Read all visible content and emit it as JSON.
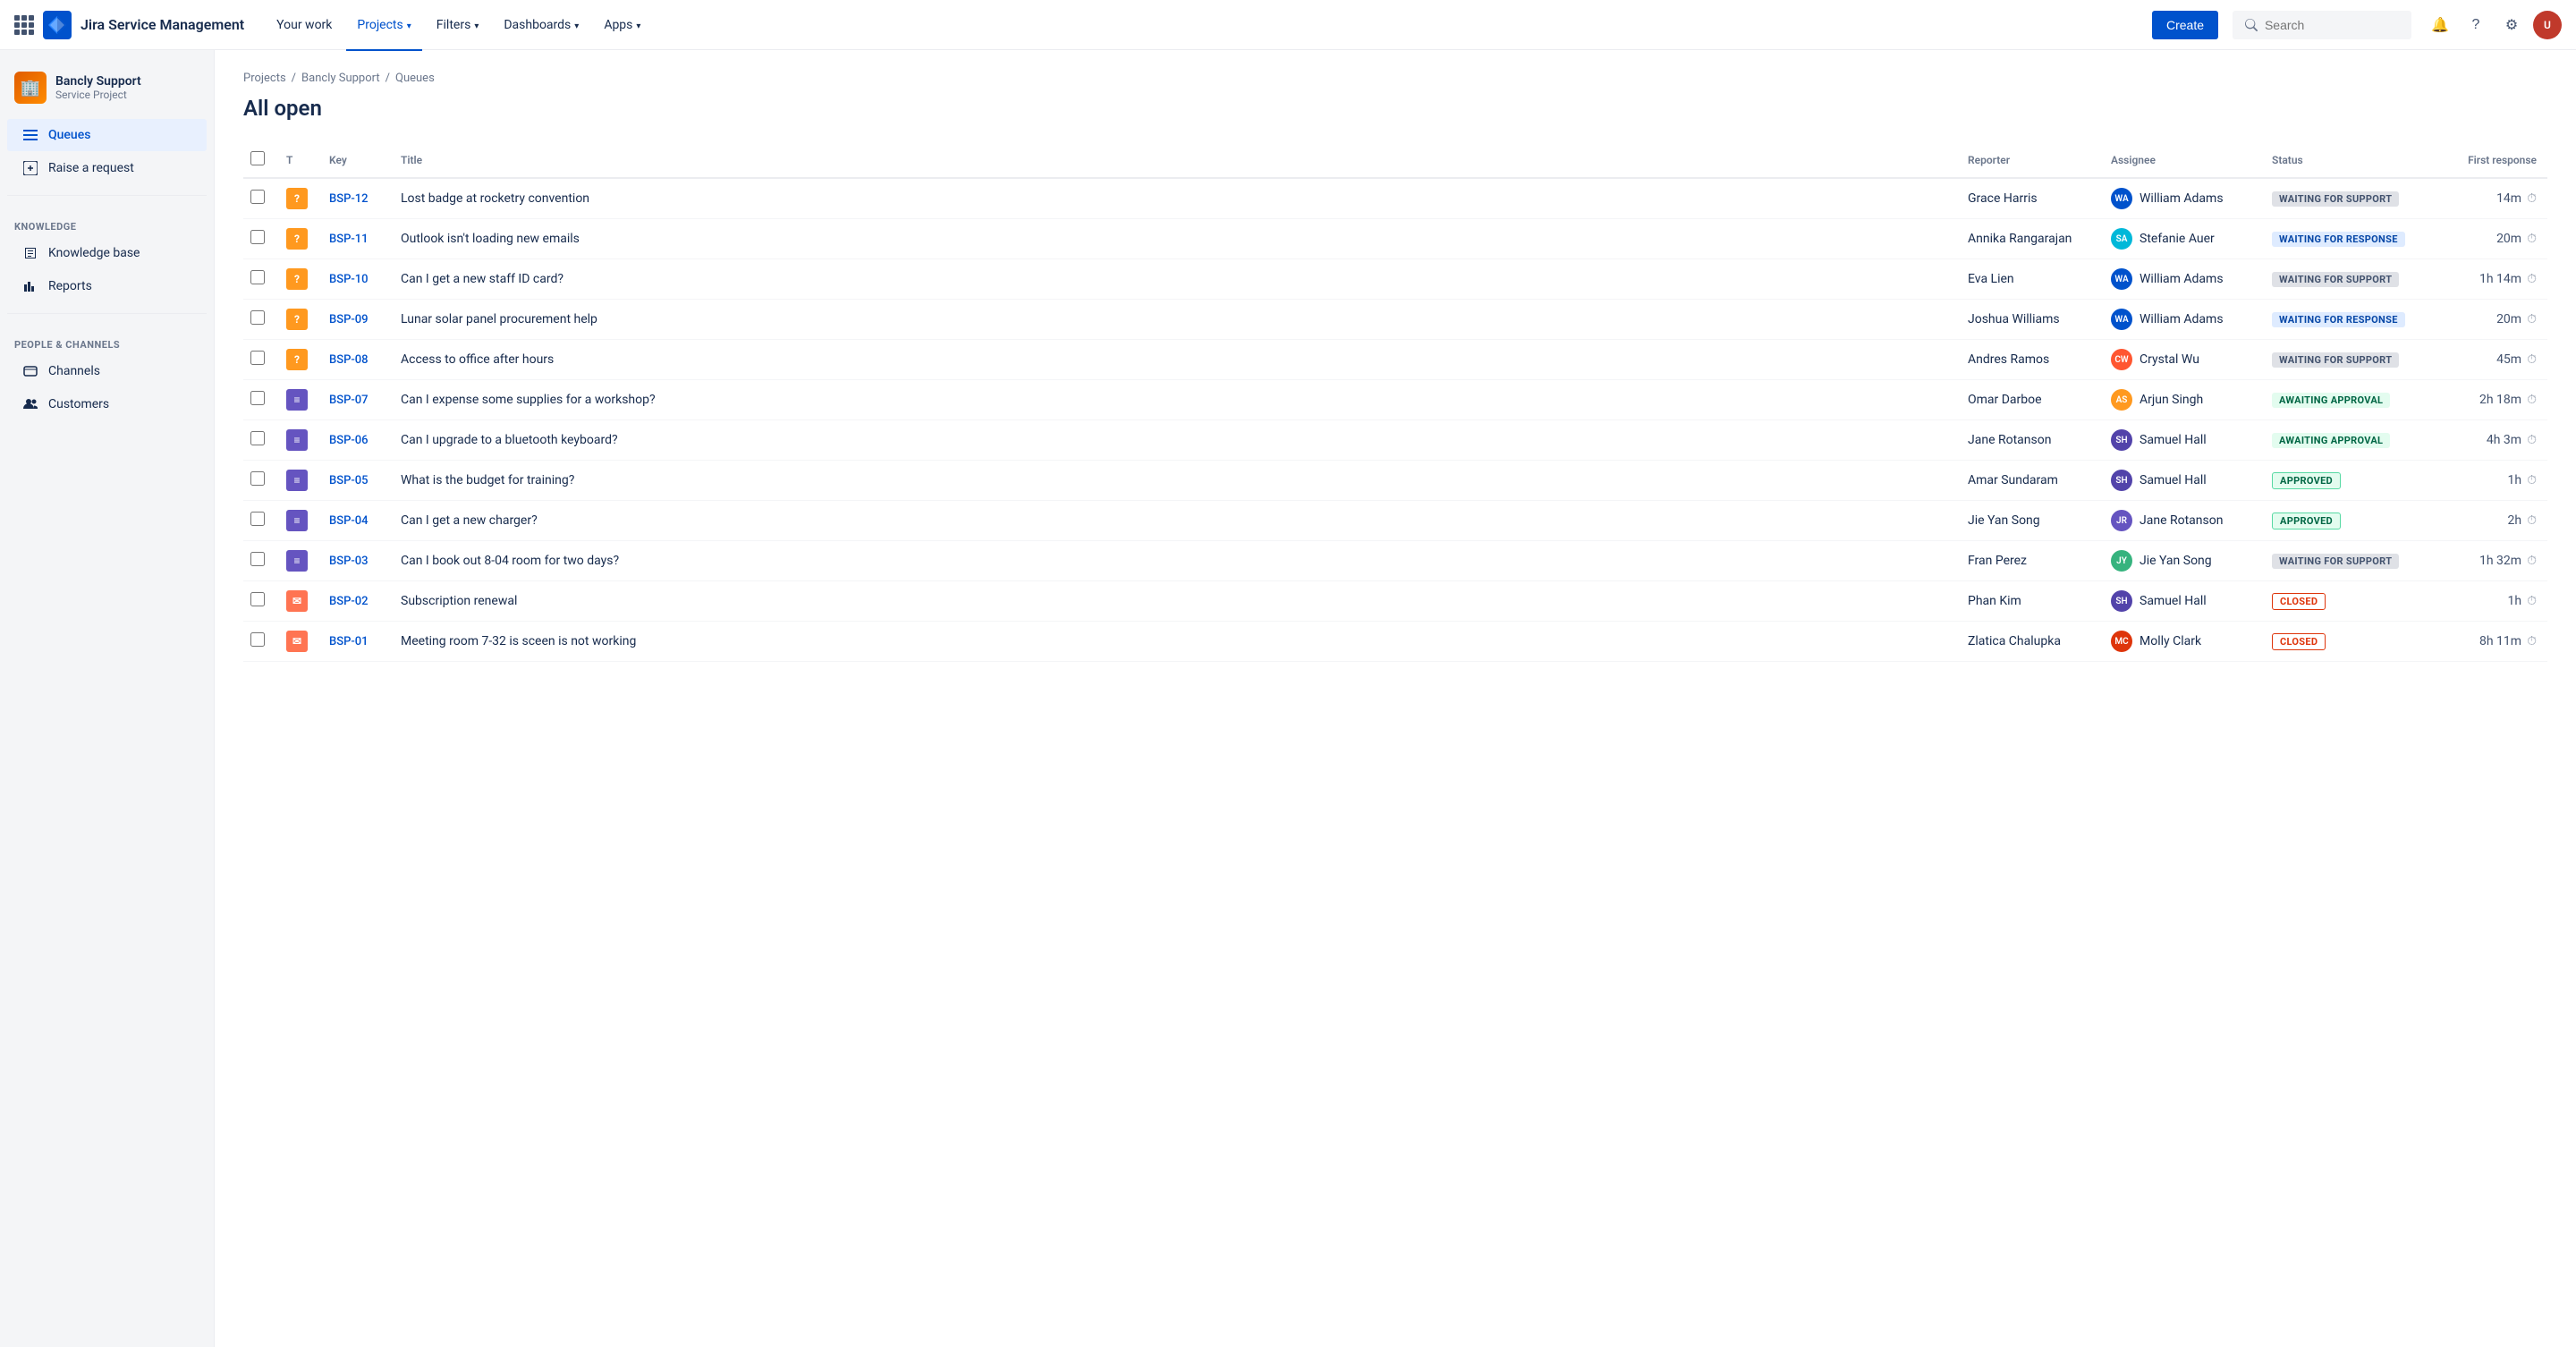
{
  "app": {
    "brand": "Jira Service Management",
    "logo_text": "⚡"
  },
  "topnav": {
    "your_work": "Your work",
    "projects": "Projects",
    "filters": "Filters",
    "dashboards": "Dashboards",
    "apps": "Apps",
    "create": "Create",
    "search_placeholder": "Search"
  },
  "sidebar": {
    "project_name": "Bancly Support",
    "project_type": "Service Project",
    "queues_label": "Queues",
    "raise_request_label": "Raise a request",
    "knowledge_section": "Knowledge",
    "knowledge_base_label": "Knowledge base",
    "reports_label": "Reports",
    "people_channels_section": "People & Channels",
    "channels_label": "Channels",
    "customers_label": "Customers"
  },
  "breadcrumb": {
    "projects": "Projects",
    "bancly_support": "Bancly Support",
    "queues": "Queues"
  },
  "page_title": "All open",
  "table": {
    "columns": {
      "type": "T",
      "key": "Key",
      "title": "Title",
      "reporter": "Reporter",
      "assignee": "Assignee",
      "status": "Status",
      "first_response": "First response"
    },
    "rows": [
      {
        "key": "BSP-12",
        "type": "question",
        "type_label": "?",
        "title": "Lost badge at rocketry convention",
        "reporter": "Grace Harris",
        "assignee": "William Adams",
        "assignee_initials": "WA",
        "assignee_color": "av-blue",
        "status": "WAITING FOR SUPPORT",
        "status_class": "status-waiting-support",
        "response": "14m"
      },
      {
        "key": "BSP-11",
        "type": "question",
        "type_label": "?",
        "title": "Outlook isn't loading new emails",
        "reporter": "Annika Rangarajan",
        "assignee": "Stefanie Auer",
        "assignee_initials": "SA",
        "assignee_color": "av-teal",
        "status": "WAITING FOR RESPONSE",
        "status_class": "status-waiting-response",
        "response": "20m"
      },
      {
        "key": "BSP-10",
        "type": "question",
        "type_label": "?",
        "title": "Can I get a new staff ID card?",
        "reporter": "Eva Lien",
        "assignee": "William Adams",
        "assignee_initials": "WA",
        "assignee_color": "av-blue",
        "status": "WAITING FOR SUPPORT",
        "status_class": "status-waiting-support",
        "response": "1h 14m"
      },
      {
        "key": "BSP-09",
        "type": "question",
        "type_label": "?",
        "title": "Lunar solar panel procurement help",
        "reporter": "Joshua Williams",
        "assignee": "William Adams",
        "assignee_initials": "WA",
        "assignee_color": "av-blue",
        "status": "WAITING FOR RESPONSE",
        "status_class": "status-waiting-response",
        "response": "20m"
      },
      {
        "key": "BSP-08",
        "type": "question",
        "type_label": "?",
        "title": "Access to office after hours",
        "reporter": "Andres Ramos",
        "assignee": "Crystal Wu",
        "assignee_initials": "CW",
        "assignee_color": "av-pink",
        "status": "WAITING FOR SUPPORT",
        "status_class": "status-waiting-support",
        "response": "45m"
      },
      {
        "key": "BSP-07",
        "type": "service",
        "type_label": "≡",
        "title": "Can I expense some supplies for a workshop?",
        "reporter": "Omar Darboe",
        "assignee": "Arjun Singh",
        "assignee_initials": "AS",
        "assignee_color": "av-orange",
        "status": "AWAITING APPROVAL",
        "status_class": "status-awaiting-approval",
        "response": "2h 18m"
      },
      {
        "key": "BSP-06",
        "type": "service",
        "type_label": "≡",
        "title": "Can I upgrade to a bluetooth keyboard?",
        "reporter": "Jane Rotanson",
        "assignee": "Samuel Hall",
        "assignee_initials": "SH",
        "assignee_color": "av-indigo",
        "status": "AWAITING APPROVAL",
        "status_class": "status-awaiting-approval",
        "response": "4h 3m"
      },
      {
        "key": "BSP-05",
        "type": "service",
        "type_label": "≡",
        "title": "What is the budget for training?",
        "reporter": "Amar Sundaram",
        "assignee": "Samuel Hall",
        "assignee_initials": "SH",
        "assignee_color": "av-indigo",
        "status": "APPROVED",
        "status_class": "status-approved",
        "response": "1h"
      },
      {
        "key": "BSP-04",
        "type": "service",
        "type_label": "≡",
        "title": "Can I get a new charger?",
        "reporter": "Jie Yan Song",
        "assignee": "Jane Rotanson",
        "assignee_initials": "JR",
        "assignee_color": "av-purple",
        "status": "APPROVED",
        "status_class": "status-approved",
        "response": "2h"
      },
      {
        "key": "BSP-03",
        "type": "service",
        "type_label": "≡",
        "title": "Can I book out 8-04 room for two days?",
        "reporter": "Fran Perez",
        "assignee": "Jie Yan Song",
        "assignee_initials": "JY",
        "assignee_color": "av-green",
        "status": "WAITING FOR SUPPORT",
        "status_class": "status-waiting-support",
        "response": "1h 32m"
      },
      {
        "key": "BSP-02",
        "type": "email",
        "type_label": "✉",
        "title": "Subscription renewal",
        "reporter": "Phan Kim",
        "assignee": "Samuel Hall",
        "assignee_initials": "SH",
        "assignee_color": "av-indigo",
        "status": "CLOSED",
        "status_class": "status-closed",
        "response": "1h"
      },
      {
        "key": "BSP-01",
        "type": "email",
        "type_label": "✉",
        "title": "Meeting room 7-32 is sceen is not working",
        "reporter": "Zlatica Chalupka",
        "assignee": "Molly Clark",
        "assignee_initials": "MC",
        "assignee_color": "av-red",
        "status": "CLOSED",
        "status_class": "status-closed",
        "response": "8h 11m"
      }
    ]
  }
}
